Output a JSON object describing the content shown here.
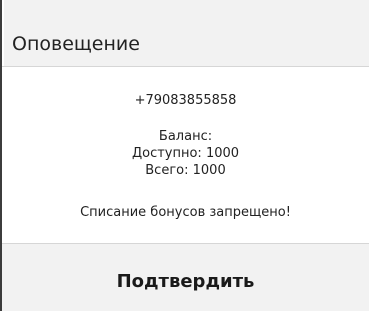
{
  "dialog": {
    "title": "Оповещение",
    "phone": "+79083855858",
    "balance_label": "Баланс:",
    "available": "Доступно: 1000",
    "total": "Всего: 1000",
    "message": "Списание бонусов запрещено!",
    "confirm_label": "Подтвердить"
  }
}
